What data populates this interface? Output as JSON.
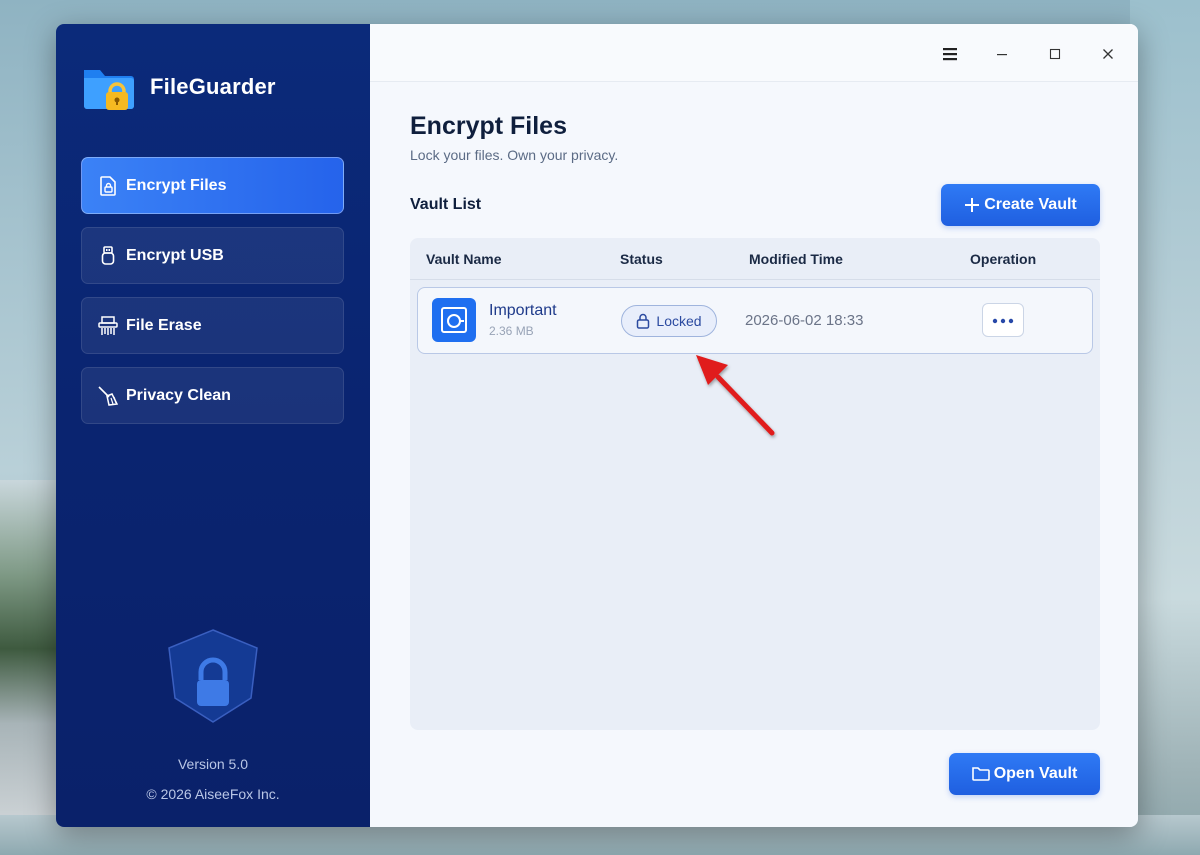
{
  "app": {
    "name": "FileGuarder"
  },
  "sidebar": {
    "items": [
      {
        "label": "Encrypt Files",
        "icon": "file-lock-icon",
        "active": true
      },
      {
        "label": "Encrypt USB",
        "icon": "usb-icon",
        "active": false
      },
      {
        "label": "File Erase",
        "icon": "shredder-icon",
        "active": false
      },
      {
        "label": "Privacy Clean",
        "icon": "broom-icon",
        "active": false
      }
    ],
    "version": "Version 5.0",
    "copyright": "© 2026 AiseeFox Inc."
  },
  "titlebar": {
    "menu_icon": "menu-icon",
    "minimize_icon": "minimize-icon",
    "maximize_icon": "maximize-icon",
    "close_icon": "close-icon"
  },
  "main": {
    "title": "Encrypt Files",
    "subtitle": "Lock your files. Own your privacy.",
    "section_title": "Vault List",
    "create_button": "Create Vault",
    "open_button": "Open Vault",
    "table": {
      "columns": [
        "Vault Name",
        "Status",
        "Modified Time",
        "Operation"
      ],
      "rows": [
        {
          "name": "Important",
          "size": "2.36 MB",
          "status": "Locked",
          "modified": "2026-06-02 18:33"
        }
      ]
    }
  },
  "colors": {
    "sidebar_bg": "#0b2a7a",
    "accent": "#2563eb",
    "annotation_arrow": "#e01b1b"
  }
}
